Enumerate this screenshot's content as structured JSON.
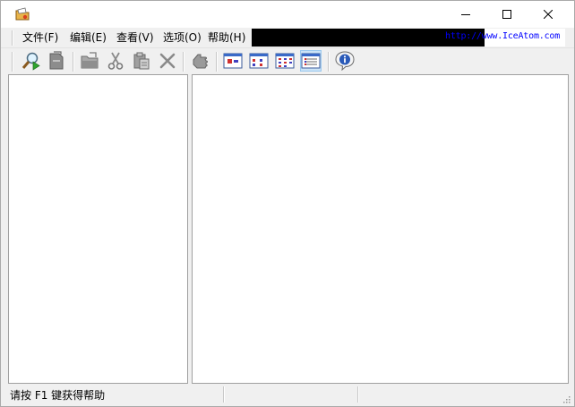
{
  "titlebar": {
    "minimize_label": "Minimize",
    "maximize_label": "Maximize",
    "close_label": "Close"
  },
  "menu": {
    "items": [
      {
        "label": "文件(F)"
      },
      {
        "label": "编辑(E)"
      },
      {
        "label": "查看(V)"
      },
      {
        "label": "选项(O)"
      },
      {
        "label": "帮助(H)"
      }
    ],
    "url": "http://www.IceAtom.com"
  },
  "toolbar": {
    "buttons": [
      {
        "icon": "search-icon"
      },
      {
        "icon": "document-icon"
      },
      {
        "icon": "folder-icon"
      },
      {
        "icon": "scissors-icon"
      },
      {
        "icon": "paste-icon"
      },
      {
        "icon": "delete-icon"
      },
      {
        "icon": "hand-icon"
      },
      {
        "icon": "large-icons-view-icon"
      },
      {
        "icon": "small-icons-view-icon"
      },
      {
        "icon": "list-view-icon"
      },
      {
        "icon": "details-view-icon"
      },
      {
        "icon": "info-icon"
      }
    ]
  },
  "statusbar": {
    "text": "请按 F1 键获得帮助"
  },
  "colors": {
    "url": "#0000ff",
    "ad_band": "#000000",
    "pressed_bg": "#cce4f7"
  }
}
